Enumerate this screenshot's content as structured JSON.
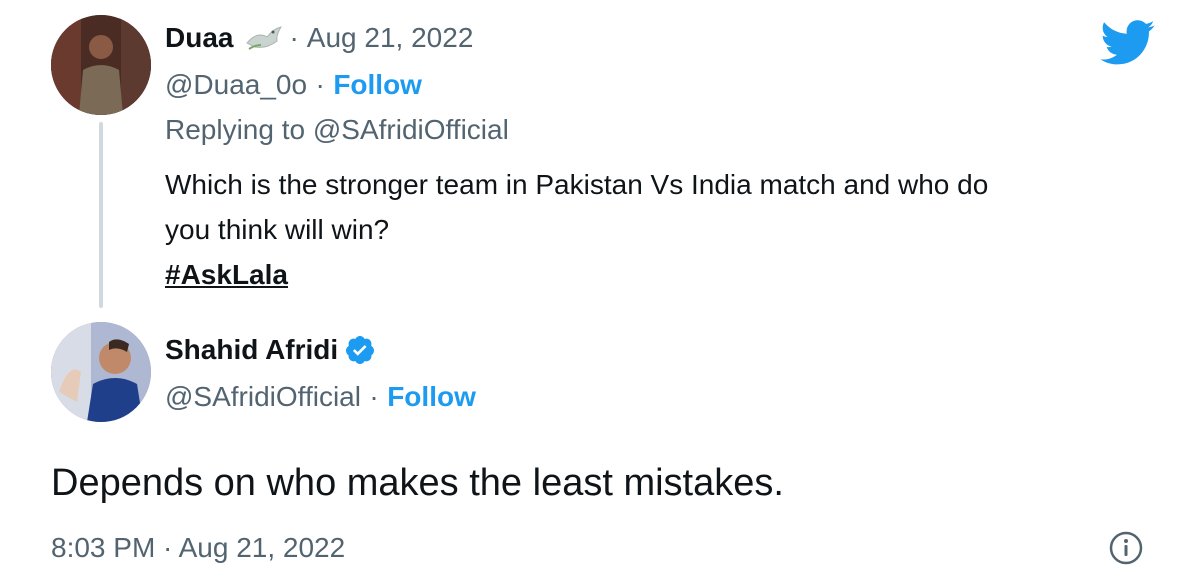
{
  "reply_to_tweet": {
    "author_name": "Duaa",
    "date": "Aug 21, 2022",
    "handle": "@Duaa_0o",
    "follow_label": "Follow",
    "replying_to": "Replying to @SAfridiOfficial",
    "text_line1": "Which is the stronger team in Pakistan Vs India match and who do",
    "text_line2": "you think will win?",
    "hashtag": "#AskLala",
    "separator": "·"
  },
  "main_tweet": {
    "author_name": "Shahid Afridi",
    "handle": "@SAfridiOfficial",
    "follow_label": "Follow",
    "text": "Depends on who makes the least mistakes.",
    "timestamp": "8:03 PM · Aug 21, 2022",
    "separator": "·"
  },
  "icons": {
    "brand": "twitter-bird-icon",
    "verified": "verified-badge-icon",
    "info": "info-icon",
    "emoji": "dove-emoji-icon"
  },
  "colors": {
    "twitter_blue": "#1d9bf0",
    "text_primary": "#0f1419",
    "text_secondary": "#536471",
    "thread_line": "#cfd9de"
  }
}
